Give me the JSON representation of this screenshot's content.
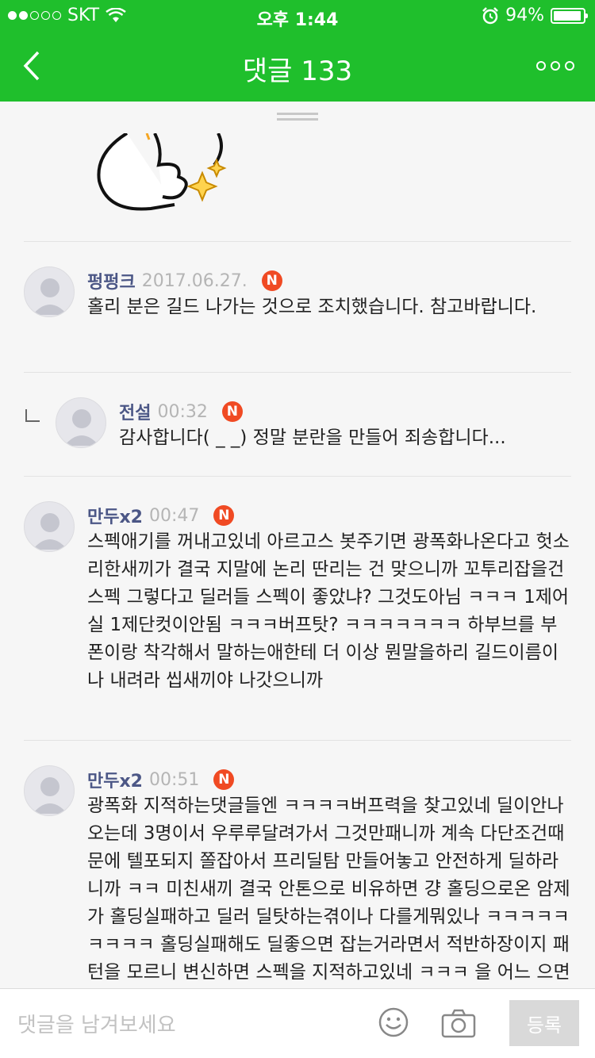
{
  "status": {
    "carrier": "SKT",
    "time": "오후 1:44",
    "battery": "94%",
    "battery_level": 0.94
  },
  "nav": {
    "title": "댓글 133"
  },
  "comments": [
    {
      "author": "펑펑크",
      "date": "2017.06.27.",
      "badge": "N",
      "text": "홀리 분은 길드 나가는 것으로 조치했습니다. 참고바랍니다."
    },
    {
      "author": "전설",
      "date": "00:32",
      "badge": "N",
      "text": "감사합니다( _ _) 정말 분란을 만들어 죄송합니다..."
    },
    {
      "author": "만두x2",
      "date": "00:47",
      "badge": "N",
      "text": "스펙애기를 꺼내고있네 아르고스 봇주기면 광폭화나온다고 헛소리한새끼가 결국 지말에 논리 딴리는 건 맞으니까 꼬투리잡을건 스펙 그렇다고 딜러들 스펙이 좋았냐? 그것도아님 ㅋㅋㅋ 1제어실 1제단컷이안됨 ㅋㅋㅋ버프탓? ㅋㅋㅋㅋㅋㅋㅋ 하부브를 부폰이랑 착각해서 말하는애한테 더 이상 뭔말을하리 길드이름이나 내려라 씹새끼야 나갓으니까"
    },
    {
      "author": "만두x2",
      "date": "00:51",
      "badge": "N",
      "text": "광폭화 지적하는댓글들엔 ㅋㅋㅋㅋ버프력을 찾고있네 딜이안나오는데 3명이서 우루루달려가서 그것만패니까 계속 다단조건때문에 텔포되지 쫄잡아서 프리딜탐 만들어놓고 안전하게 딜하라니까 ㅋㅋ 미친새끼 결국 안톤으로 비유하면 걍 홀딩으로온 암제가 홀딩실패하고 딜러 딜탓하는겪이나 다를게뭐있나 ㅋㅋㅋㅋㅋㅋㅋㅋㅋ 홀딩실패해도 딜좋으면 잡는거라면서 적반하장이지 패턴을 모르니 변신하면 스펙을 지적하고있네 ㅋㅋㅋ 을 어느 으면"
    }
  ],
  "input": {
    "placeholder": "댓글을 남겨보세요",
    "submit_label": "등록"
  }
}
